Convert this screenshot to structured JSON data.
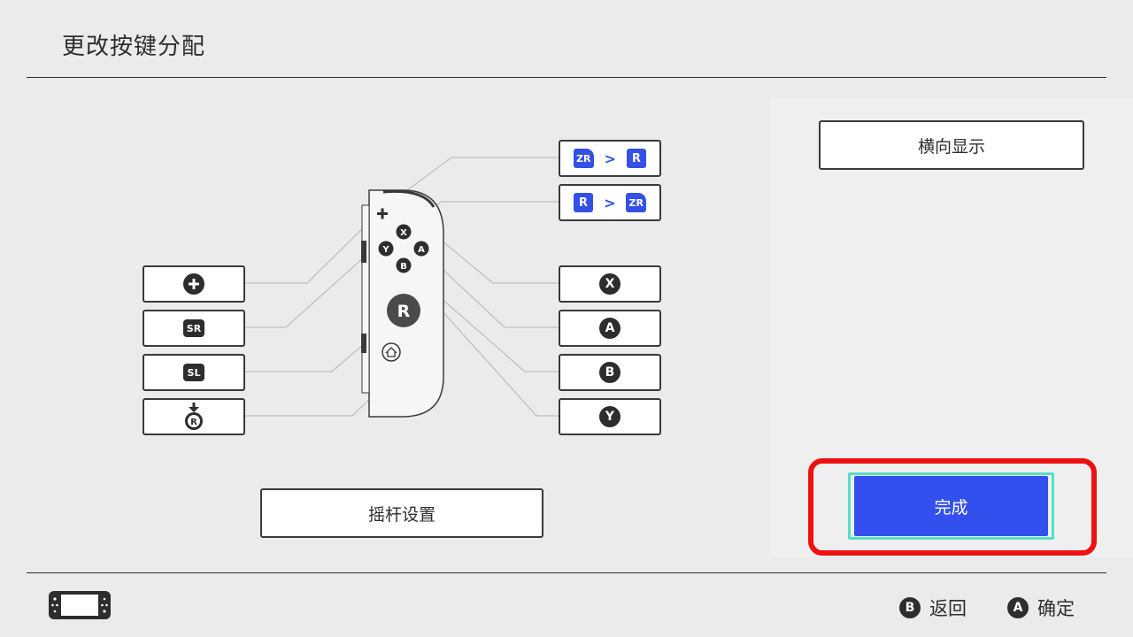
{
  "page": {
    "title": "更改按键分配"
  },
  "left_mappings": [
    {
      "label": "+"
    },
    {
      "label": "SR"
    },
    {
      "label": "SL"
    },
    {
      "label": "R"
    }
  ],
  "right_mappings": [
    {
      "from": "ZR",
      "arrow": ">",
      "to": "R"
    },
    {
      "from": "R",
      "arrow": ">",
      "to": "ZR"
    },
    {
      "label": "X"
    },
    {
      "label": "A"
    },
    {
      "label": "B"
    },
    {
      "label": "Y"
    }
  ],
  "controller": {
    "plus": "+",
    "x": "X",
    "y": "Y",
    "a": "A",
    "b": "B",
    "stick": "R"
  },
  "buttons": {
    "stick_settings": "摇杆设置",
    "landscape": "横向显示",
    "done": "完成"
  },
  "footer": {
    "back": {
      "button": "B",
      "label": "返回"
    },
    "confirm": {
      "button": "A",
      "label": "确定"
    }
  },
  "colors": {
    "accent_blue": "#3350ee",
    "highlight_red": "#ee1111",
    "focus_teal": "#52e0c8"
  }
}
